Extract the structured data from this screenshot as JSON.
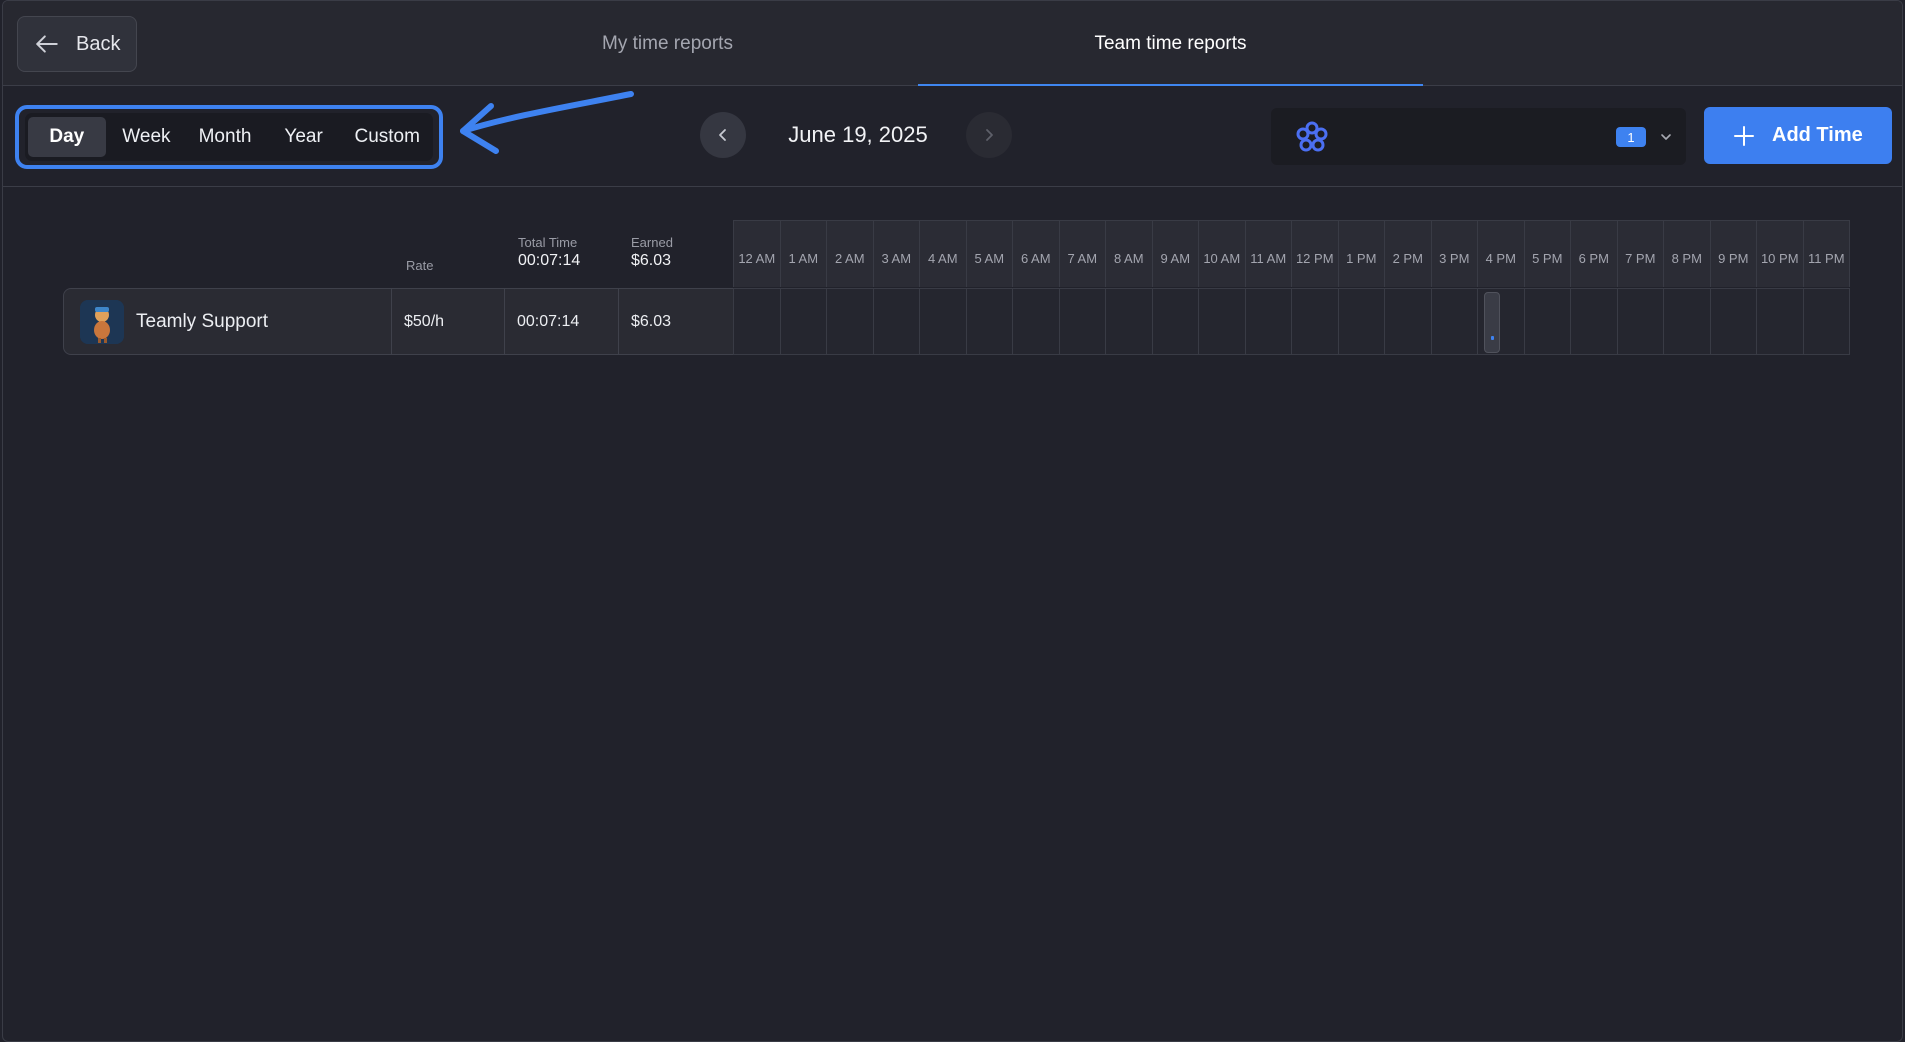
{
  "topbar": {
    "back_label": "Back",
    "tabs": [
      {
        "label": "My time reports",
        "active": false
      },
      {
        "label": "Team time reports",
        "active": true
      }
    ]
  },
  "toolbar": {
    "periods": [
      {
        "label": "Day",
        "active": true
      },
      {
        "label": "Week",
        "active": false
      },
      {
        "label": "Month",
        "active": false
      },
      {
        "label": "Year",
        "active": false
      },
      {
        "label": "Custom",
        "active": false
      }
    ],
    "date": "June 19, 2025",
    "team_select": {
      "count": "1",
      "icon": "flower-logo-icon"
    },
    "add_time_label": "Add Time"
  },
  "table": {
    "headers": {
      "rate": "Rate",
      "total_time_label": "Total Time",
      "total_time_value": "00:07:14",
      "earned_label": "Earned",
      "earned_value": "$6.03"
    },
    "hours": [
      "12 AM",
      "1 AM",
      "2 AM",
      "3 AM",
      "4 AM",
      "5 AM",
      "6 AM",
      "7 AM",
      "8 AM",
      "9 AM",
      "10 AM",
      "11 AM",
      "12 PM",
      "1 PM",
      "2 PM",
      "3 PM",
      "4 PM",
      "5 PM",
      "6 PM",
      "7 PM",
      "8 PM",
      "9 PM",
      "10 PM",
      "11 PM"
    ],
    "rows": [
      {
        "name": "Teamly Support",
        "rate": "$50/h",
        "total_time": "00:07:14",
        "earned": "$6.03",
        "entry_hour_index": 16
      }
    ]
  },
  "colors": {
    "accent": "#3e82f0",
    "background": "#21222b",
    "panel": "#2a2b33"
  }
}
